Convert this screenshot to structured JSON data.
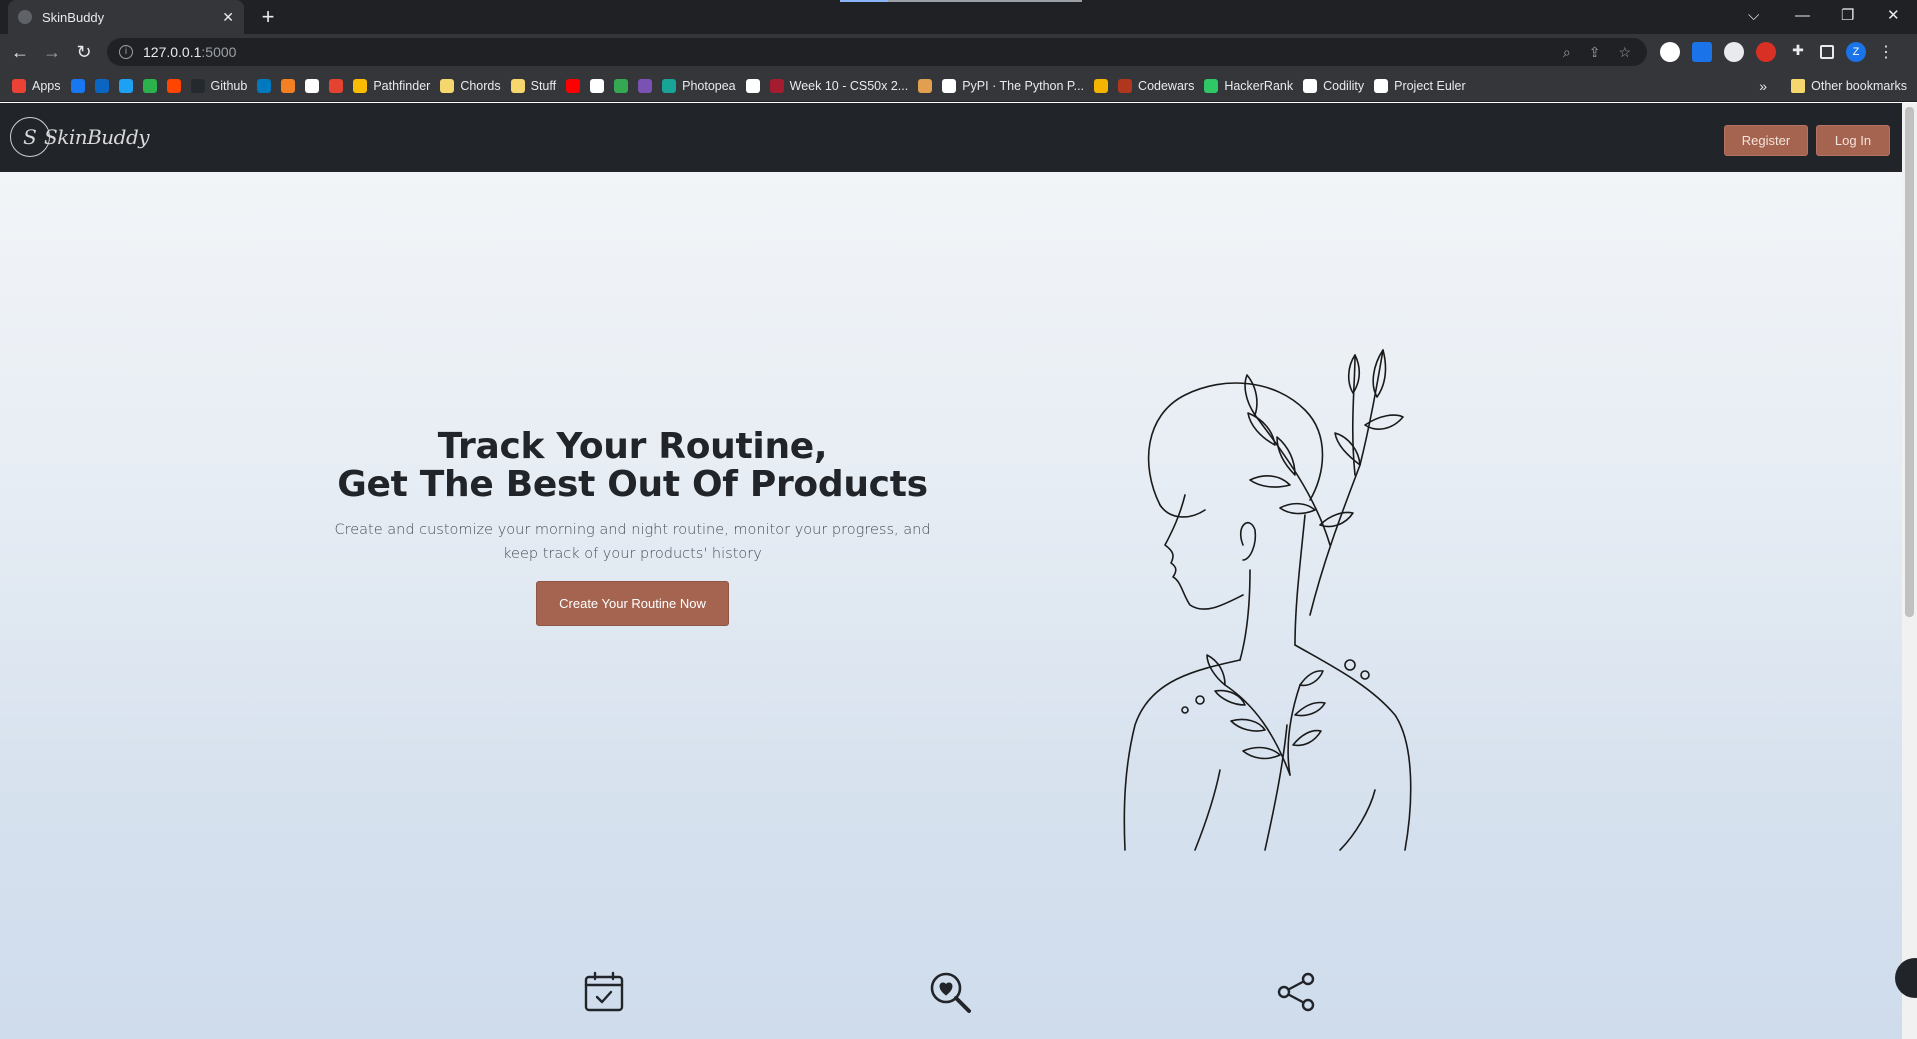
{
  "browser": {
    "tab_title": "SkinBuddy",
    "tab_close": "✕",
    "new_tab": "+",
    "url_host": "127.0.0.1",
    "url_port": ":5000",
    "window_controls": [
      "⌵",
      "—",
      "❐",
      "✕"
    ],
    "bookmarks": [
      {
        "label": "Apps",
        "icon": "apps-grid-icon",
        "color": "#ea4335"
      },
      {
        "label": "",
        "icon": "facebook-icon",
        "color": "#1877f2"
      },
      {
        "label": "",
        "icon": "linkedin-icon",
        "color": "#0a66c2"
      },
      {
        "label": "",
        "icon": "twitter-icon",
        "color": "#1da1f2"
      },
      {
        "label": "",
        "icon": "feedly-icon",
        "color": "#2bb24c"
      },
      {
        "label": "",
        "icon": "reddit-icon",
        "color": "#ff4500"
      },
      {
        "label": "Github",
        "icon": "github-icon",
        "color": "#24292e"
      },
      {
        "label": "",
        "icon": "trello-icon",
        "color": "#0079bf"
      },
      {
        "label": "",
        "icon": "stackoverflow-icon",
        "color": "#f48024"
      },
      {
        "label": "",
        "icon": "notion-icon",
        "color": "#ffffff"
      },
      {
        "label": "",
        "icon": "todoist-icon",
        "color": "#e44332"
      },
      {
        "label": "Pathfinder",
        "icon": "drive-icon",
        "color": "#fbbc04"
      },
      {
        "label": "Chords",
        "icon": "folder-icon",
        "color": "#f5d76e"
      },
      {
        "label": "Stuff",
        "icon": "folder-icon",
        "color": "#f5d76e"
      },
      {
        "label": "",
        "icon": "youtube-icon",
        "color": "#ff0000"
      },
      {
        "label": "",
        "icon": "app-icon",
        "color": "#ffffff"
      },
      {
        "label": "",
        "icon": "w-icon",
        "color": "#34a853"
      },
      {
        "label": "",
        "icon": "bootstrap-icon",
        "color": "#7952b3"
      },
      {
        "label": "Photopea",
        "icon": "photopea-icon",
        "color": "#18a497"
      },
      {
        "label": "",
        "icon": "r-icon",
        "color": "#ffffff"
      },
      {
        "label": "Week 10 - CS50x 2...",
        "icon": "harvard-icon",
        "color": "#a51c30"
      },
      {
        "label": "",
        "icon": "shield-icon",
        "color": "#e0a050"
      },
      {
        "label": "PyPI · The Python P...",
        "icon": "pypi-icon",
        "color": "#ffffff"
      },
      {
        "label": "",
        "icon": "circle-icon",
        "color": "#f4b400"
      },
      {
        "label": "Codewars",
        "icon": "codewars-icon",
        "color": "#b1361e"
      },
      {
        "label": "HackerRank",
        "icon": "hackerrank-icon",
        "color": "#2ec866"
      },
      {
        "label": "Codility",
        "icon": "codility-icon",
        "color": "#ffffff"
      },
      {
        "label": "Project Euler",
        "icon": "euler-icon",
        "color": "#ffffff"
      }
    ],
    "more_bookmarks": "»",
    "other_bookmarks": "Other bookmarks",
    "profile_initial": "Z"
  },
  "site": {
    "logo_mark": "S",
    "logo_text": "SkinBuddy",
    "nav": {
      "register": "Register",
      "login": "Log In"
    },
    "hero": {
      "title_line1": "Track Your Routine,",
      "title_line2": "Get The Best Out Of Products",
      "subtitle": "Create and customize your morning and night routine, monitor your progress, and keep track of your products' history",
      "cta": "Create Your Routine Now"
    },
    "features": [
      {
        "icon": "calendar-check-icon"
      },
      {
        "icon": "search-heart-icon"
      },
      {
        "icon": "share-icon"
      }
    ],
    "colors": {
      "accent": "#a56450",
      "navbar": "#212529"
    }
  }
}
